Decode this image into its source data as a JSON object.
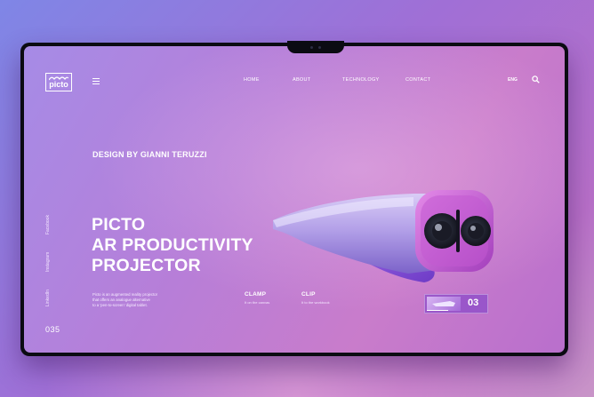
{
  "nav": {
    "logo_text": "picto",
    "links": [
      "HOME",
      "ABOUT",
      "TECHNOLOGY",
      "CONTACT"
    ],
    "lang": "ENG"
  },
  "hero": {
    "designer": "DESIGN BY GIANNI TERUZZI",
    "headline": [
      "PICTO",
      "AR PRODUCTIVITY",
      "PROJECTOR"
    ],
    "description": [
      "Picto is an augmented reality projector",
      "that offers an analogue alternative",
      "to a 'pen-to-screen' digital tablet."
    ]
  },
  "social": [
    "Facebook",
    "Instagram",
    "LinkedIn"
  ],
  "page_number": "035",
  "features": [
    {
      "title": "CLAMP",
      "subtitle": "It on the canvas"
    },
    {
      "title": "CLIP",
      "subtitle": "It to the workbook"
    }
  ],
  "slider": {
    "number": "03"
  },
  "colors": {
    "accent": "#c06ad9",
    "device_body": "#b8a3e6",
    "background": "#b77ed8"
  },
  "icons": {
    "menu": "hamburger-icon",
    "search": "search-icon"
  }
}
